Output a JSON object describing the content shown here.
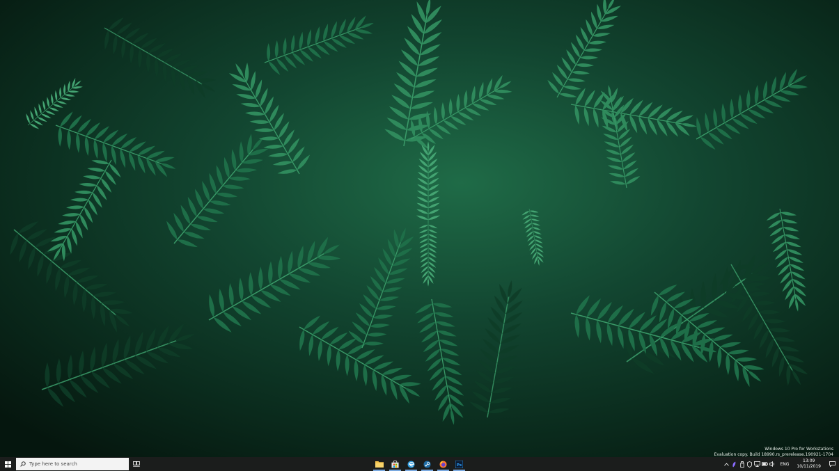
{
  "wallpaper": {
    "subject": "green fern leaves",
    "colors": {
      "deep": "#061a11",
      "mid": "#134a31",
      "leaf": "#2f8a5c",
      "leaf_light": "#49a877"
    }
  },
  "watermark": {
    "line1": "Windows 10 Pro for Workstations",
    "line2": "Evaluation copy. Build 18990.rs_prerelease.190921-1704"
  },
  "taskbar": {
    "background": "#1b1d1c",
    "start_icon": "windows-logo-icon",
    "search": {
      "placeholder": "Type here to search"
    },
    "task_view_icon": "task-view-icon",
    "apps": [
      {
        "name": "file-explorer",
        "icon": "folder-icon",
        "color": "#f5c24a"
      },
      {
        "name": "microsoft-store",
        "icon": "store-bag-icon",
        "color": "#e8e8e8"
      },
      {
        "name": "edge",
        "icon": "edge-icon",
        "color": "#2f9ddf"
      },
      {
        "name": "steam",
        "icon": "steam-icon",
        "color": "#1f6ea8"
      },
      {
        "name": "firefox",
        "icon": "firefox-icon",
        "color": "#ff7a2c"
      },
      {
        "name": "photoshop",
        "icon": "photoshop-icon",
        "color": "#2fa3f7",
        "label": "Ps"
      }
    ],
    "tray": {
      "language": "ENG",
      "time": "13:09",
      "date": "10/11/2019"
    }
  }
}
